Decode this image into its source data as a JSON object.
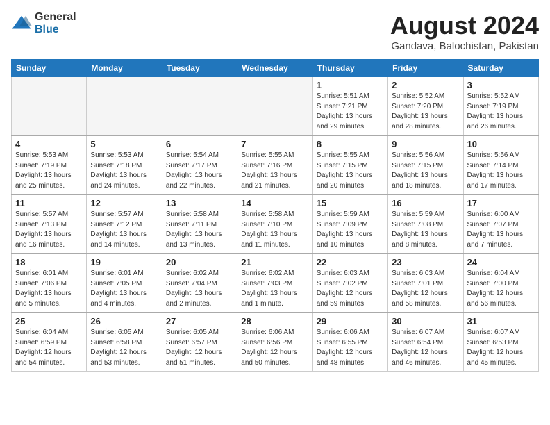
{
  "logo": {
    "general": "General",
    "blue": "Blue"
  },
  "title": "August 2024",
  "location": "Gandava, Balochistan, Pakistan",
  "days_of_week": [
    "Sunday",
    "Monday",
    "Tuesday",
    "Wednesday",
    "Thursday",
    "Friday",
    "Saturday"
  ],
  "weeks": [
    [
      {
        "day": "",
        "info": ""
      },
      {
        "day": "",
        "info": ""
      },
      {
        "day": "",
        "info": ""
      },
      {
        "day": "",
        "info": ""
      },
      {
        "day": "1",
        "info": "Sunrise: 5:51 AM\nSunset: 7:21 PM\nDaylight: 13 hours\nand 29 minutes."
      },
      {
        "day": "2",
        "info": "Sunrise: 5:52 AM\nSunset: 7:20 PM\nDaylight: 13 hours\nand 28 minutes."
      },
      {
        "day": "3",
        "info": "Sunrise: 5:52 AM\nSunset: 7:19 PM\nDaylight: 13 hours\nand 26 minutes."
      }
    ],
    [
      {
        "day": "4",
        "info": "Sunrise: 5:53 AM\nSunset: 7:19 PM\nDaylight: 13 hours\nand 25 minutes."
      },
      {
        "day": "5",
        "info": "Sunrise: 5:53 AM\nSunset: 7:18 PM\nDaylight: 13 hours\nand 24 minutes."
      },
      {
        "day": "6",
        "info": "Sunrise: 5:54 AM\nSunset: 7:17 PM\nDaylight: 13 hours\nand 22 minutes."
      },
      {
        "day": "7",
        "info": "Sunrise: 5:55 AM\nSunset: 7:16 PM\nDaylight: 13 hours\nand 21 minutes."
      },
      {
        "day": "8",
        "info": "Sunrise: 5:55 AM\nSunset: 7:15 PM\nDaylight: 13 hours\nand 20 minutes."
      },
      {
        "day": "9",
        "info": "Sunrise: 5:56 AM\nSunset: 7:15 PM\nDaylight: 13 hours\nand 18 minutes."
      },
      {
        "day": "10",
        "info": "Sunrise: 5:56 AM\nSunset: 7:14 PM\nDaylight: 13 hours\nand 17 minutes."
      }
    ],
    [
      {
        "day": "11",
        "info": "Sunrise: 5:57 AM\nSunset: 7:13 PM\nDaylight: 13 hours\nand 16 minutes."
      },
      {
        "day": "12",
        "info": "Sunrise: 5:57 AM\nSunset: 7:12 PM\nDaylight: 13 hours\nand 14 minutes."
      },
      {
        "day": "13",
        "info": "Sunrise: 5:58 AM\nSunset: 7:11 PM\nDaylight: 13 hours\nand 13 minutes."
      },
      {
        "day": "14",
        "info": "Sunrise: 5:58 AM\nSunset: 7:10 PM\nDaylight: 13 hours\nand 11 minutes."
      },
      {
        "day": "15",
        "info": "Sunrise: 5:59 AM\nSunset: 7:09 PM\nDaylight: 13 hours\nand 10 minutes."
      },
      {
        "day": "16",
        "info": "Sunrise: 5:59 AM\nSunset: 7:08 PM\nDaylight: 13 hours\nand 8 minutes."
      },
      {
        "day": "17",
        "info": "Sunrise: 6:00 AM\nSunset: 7:07 PM\nDaylight: 13 hours\nand 7 minutes."
      }
    ],
    [
      {
        "day": "18",
        "info": "Sunrise: 6:01 AM\nSunset: 7:06 PM\nDaylight: 13 hours\nand 5 minutes."
      },
      {
        "day": "19",
        "info": "Sunrise: 6:01 AM\nSunset: 7:05 PM\nDaylight: 13 hours\nand 4 minutes."
      },
      {
        "day": "20",
        "info": "Sunrise: 6:02 AM\nSunset: 7:04 PM\nDaylight: 13 hours\nand 2 minutes."
      },
      {
        "day": "21",
        "info": "Sunrise: 6:02 AM\nSunset: 7:03 PM\nDaylight: 13 hours\nand 1 minute."
      },
      {
        "day": "22",
        "info": "Sunrise: 6:03 AM\nSunset: 7:02 PM\nDaylight: 12 hours\nand 59 minutes."
      },
      {
        "day": "23",
        "info": "Sunrise: 6:03 AM\nSunset: 7:01 PM\nDaylight: 12 hours\nand 58 minutes."
      },
      {
        "day": "24",
        "info": "Sunrise: 6:04 AM\nSunset: 7:00 PM\nDaylight: 12 hours\nand 56 minutes."
      }
    ],
    [
      {
        "day": "25",
        "info": "Sunrise: 6:04 AM\nSunset: 6:59 PM\nDaylight: 12 hours\nand 54 minutes."
      },
      {
        "day": "26",
        "info": "Sunrise: 6:05 AM\nSunset: 6:58 PM\nDaylight: 12 hours\nand 53 minutes."
      },
      {
        "day": "27",
        "info": "Sunrise: 6:05 AM\nSunset: 6:57 PM\nDaylight: 12 hours\nand 51 minutes."
      },
      {
        "day": "28",
        "info": "Sunrise: 6:06 AM\nSunset: 6:56 PM\nDaylight: 12 hours\nand 50 minutes."
      },
      {
        "day": "29",
        "info": "Sunrise: 6:06 AM\nSunset: 6:55 PM\nDaylight: 12 hours\nand 48 minutes."
      },
      {
        "day": "30",
        "info": "Sunrise: 6:07 AM\nSunset: 6:54 PM\nDaylight: 12 hours\nand 46 minutes."
      },
      {
        "day": "31",
        "info": "Sunrise: 6:07 AM\nSunset: 6:53 PM\nDaylight: 12 hours\nand 45 minutes."
      }
    ]
  ]
}
